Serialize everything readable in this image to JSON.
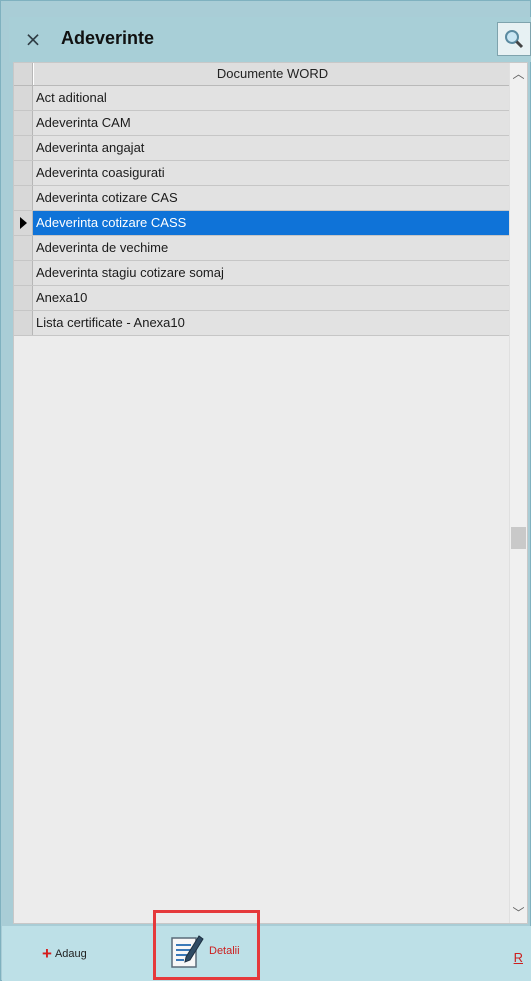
{
  "window": {
    "title": "Adeverinte",
    "close_icon": "close-x-icon",
    "search_icon": "magnifier-icon"
  },
  "grid": {
    "column_header": "Documente WORD",
    "rows": [
      {
        "label": "Act aditional",
        "selected": false
      },
      {
        "label": "Adeverinta CAM",
        "selected": false
      },
      {
        "label": "Adeverinta angajat",
        "selected": false
      },
      {
        "label": "Adeverinta coasigurati",
        "selected": false
      },
      {
        "label": "Adeverinta cotizare  CAS",
        "selected": false
      },
      {
        "label": "Adeverinta cotizare CASS",
        "selected": true
      },
      {
        "label": "Adeverinta de vechime",
        "selected": false
      },
      {
        "label": "Adeverinta stagiu cotizare somaj",
        "selected": false
      },
      {
        "label": "Anexa10",
        "selected": false
      },
      {
        "label": "Lista certificate - Anexa10",
        "selected": false
      }
    ]
  },
  "toolbar": {
    "add_label": "Adaug",
    "details_label": "Detalii",
    "r_label": "R"
  },
  "colors": {
    "selection": "#0f73d8",
    "accent_red": "#cc2020",
    "frame": "#a9cdd6"
  }
}
